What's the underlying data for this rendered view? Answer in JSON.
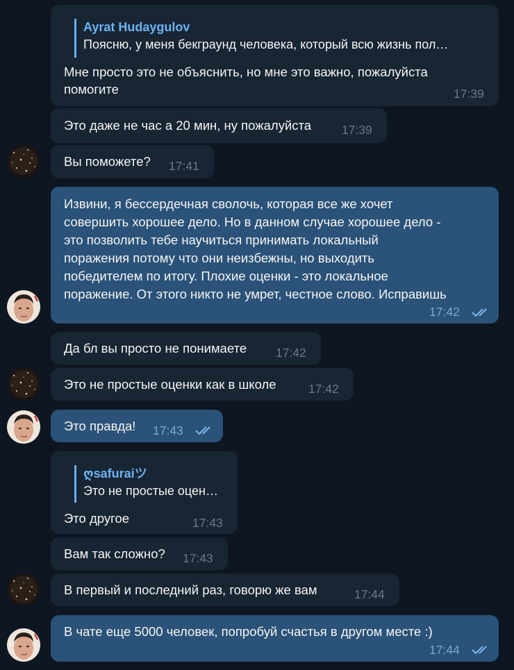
{
  "colors": {
    "background": "#0e1621",
    "incoming_bubble": "#182533",
    "outgoing_bubble": "#2b5278",
    "reply_accent": "#6ab3f3",
    "read_ticks": "#7fb8ef"
  },
  "messages": [
    {
      "direction": "in",
      "reply_to": {
        "name": "Ayrat Hudaygulov",
        "text": "Поясню, у меня бекграунд человека, который всю жизнь пол…"
      },
      "lines": [
        "Мне просто это не объяснить, но мне это важно, пожалуйста",
        "помогите"
      ],
      "time": "17:39"
    },
    {
      "direction": "in",
      "lines": [
        "Это даже не час а 20 мин, ну пожалуйста"
      ],
      "time": "17:39"
    },
    {
      "direction": "in",
      "lines": [
        "Вы поможете?"
      ],
      "time": "17:41",
      "avatar": "starry-avatar"
    },
    {
      "direction": "out",
      "lines": [
        "Извини, я бессердечная сволочь, которая все же хочет",
        "совершить хорошее дело. Но в данном случае хорошее дело -",
        "это позволить тебе научиться принимать локальный",
        "поражения потому что они неизбежны, но выходить",
        "победителем по итогу. Плохие оценки - это локальное",
        "поражение. От этого никто не умрет, честное слово. Исправишь"
      ],
      "time": "17:42",
      "read_ticks": "double-check-icon",
      "avatar": "man-avatar"
    },
    {
      "direction": "in",
      "lines": [
        "Да бл вы просто не понимаете"
      ],
      "time": "17:42"
    },
    {
      "direction": "in",
      "lines": [
        "Это не простые оценки как в школе"
      ],
      "time": "17:42",
      "avatar": "starry-avatar"
    },
    {
      "direction": "out",
      "lines": [
        "Это правда!"
      ],
      "time": "17:43",
      "read_ticks": "double-check-icon",
      "avatar": "man-avatar"
    },
    {
      "direction": "in",
      "reply_to": {
        "name": "ღsafuraiツ",
        "text": "Это не простые оцен…"
      },
      "lines": [
        "Это другое"
      ],
      "time": "17:43"
    },
    {
      "direction": "in",
      "lines": [
        "Вам так сложно?"
      ],
      "time": "17:43"
    },
    {
      "direction": "in",
      "lines": [
        "В первый и последний раз, говорю же вам"
      ],
      "time": "17:44",
      "avatar": "starry-avatar"
    },
    {
      "direction": "out",
      "lines": [
        "В чате еще 5000 человек, попробуй счастья в другом месте :)"
      ],
      "time": "17:44",
      "read_ticks": "double-check-icon",
      "avatar": "man-avatar"
    }
  ]
}
